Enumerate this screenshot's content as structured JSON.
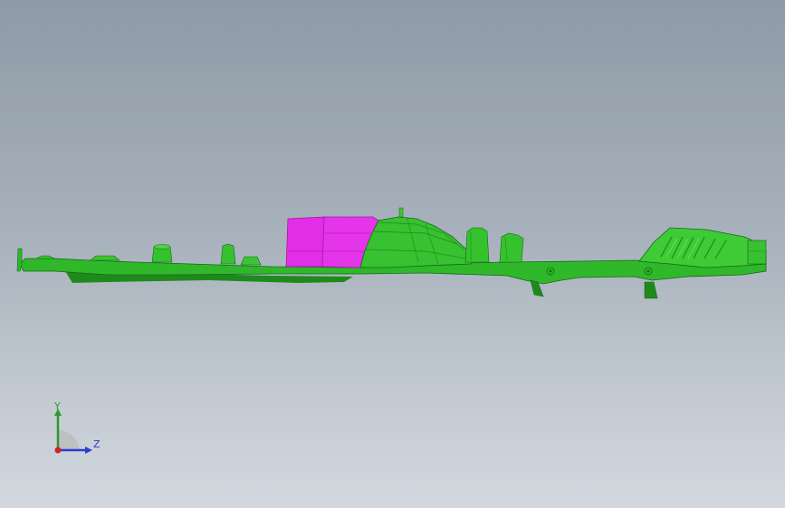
{
  "viewport": {
    "background_top": "#8e9aa6",
    "background_bottom": "#d2d8de"
  },
  "model": {
    "name": "",
    "body_color": "#2fb82a",
    "body_dark": "#1f8a1c",
    "body_light": "#55d84c",
    "highlight_color": "#e22ee6",
    "highlight_dark": "#b01bb5"
  },
  "triad": {
    "y_label": "Y",
    "z_label": "Z",
    "y_color": "#2d9a2d",
    "z_color": "#2b3ccf",
    "origin_color": "#d42020"
  }
}
